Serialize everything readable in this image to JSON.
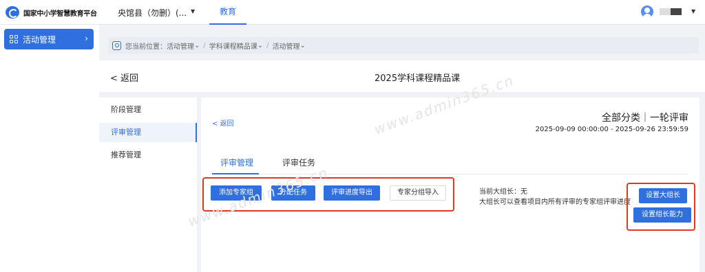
{
  "topbar": {
    "platform_name": "国家中小学智慧教育平台",
    "county": "央馆县（勿删）(...",
    "nav_education": "教育"
  },
  "sidebar": {
    "items": [
      {
        "label": "活动管理",
        "icon": "grid-icon"
      }
    ]
  },
  "breadcrumb": {
    "prefix": "您当前位置：",
    "items": [
      "活动管理",
      "学科课程精品课",
      "活动管理"
    ]
  },
  "header": {
    "back_label": "< 返回",
    "title": "2025学科课程精品课"
  },
  "menu": {
    "items": [
      "阶段管理",
      "评审管理",
      "推荐管理"
    ],
    "active_index": 1
  },
  "content": {
    "back_label": "< 返回",
    "category": "全部分类｜一轮评审",
    "date_range": "2025-09-09 00:00:00 - 2025-09-26 23:59:59",
    "tabs": [
      "评审管理",
      "评审任务"
    ],
    "active_tab": 0,
    "buttons": {
      "add_group": "添加专家组",
      "assign_task": "分配任务",
      "export_progress": "评审进度导出",
      "import_groups": "专家分组导入",
      "set_leader": "设置大组长",
      "set_leader_ability": "设置组长能力"
    },
    "leader_label": "当前大组长：无",
    "leader_note": "大组长可以查看项目内所有评审的专家组评审进度"
  },
  "watermark": "www.admin365.cn",
  "colors": {
    "primary": "#2f6fde",
    "highlight": "#e0381f"
  }
}
